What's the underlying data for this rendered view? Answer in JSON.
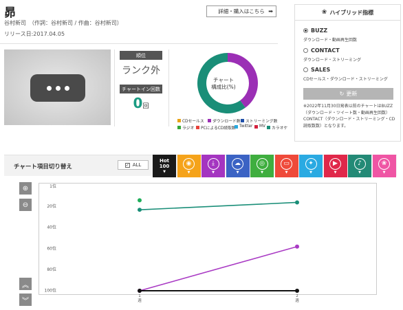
{
  "song": {
    "title": "昴",
    "credits": "谷村新司　（作詞：谷村新司 / 作曲：谷村新司）",
    "release": "リリース日:2017.04.05"
  },
  "buy_button": {
    "label": "詳細・購入はこちら",
    "arrow": "➡"
  },
  "rank": {
    "label": "順位",
    "value": "ランク外"
  },
  "chart_in": {
    "label": "チャートイン回数",
    "value": "0",
    "unit": "回"
  },
  "donut": {
    "center_line1": "チャート",
    "center_line2": "構成比(%)",
    "segments": [
      {
        "name": "ダウンロード数",
        "value": 40,
        "color": "#9b2fb5"
      },
      {
        "name": "カラオケ",
        "value": 60,
        "color": "#1a8e78"
      }
    ],
    "legend": [
      {
        "label": "CDセールス",
        "color": "#e8a317"
      },
      {
        "label": "ダウンロード数",
        "color": "#9b2fb5"
      },
      {
        "label": "ストリーミング数",
        "color": "#1f4fa8"
      },
      {
        "label": "ラジオ",
        "color": "#35a83a"
      },
      {
        "label": "PCによるCD読取数",
        "color": "#e8423a"
      },
      {
        "label": "Twitter",
        "color": "#2aa9e0"
      },
      {
        "label": "MV",
        "color": "#d4213d"
      },
      {
        "label": "カラオケ",
        "color": "#1a8e78"
      }
    ]
  },
  "hybrid": {
    "title": "ハイブリッド指標",
    "options": [
      {
        "label": "BUZZ",
        "sub": "ダウンロード・動画再生回数",
        "selected": true
      },
      {
        "label": "CONTACT",
        "sub": "ダウンロード・ストリーミング",
        "selected": false
      },
      {
        "label": "SALES",
        "sub": "CDセールス・ダウンロード・ストリーミング",
        "selected": false
      }
    ],
    "update_label": "更新",
    "note": "※2022年11月30日発表以前のチャートはBUZZ（ダウンロード・ツイート数・動画再生回数）CONTACT（ダウンロード・ストリーミング・CD読取数数）となります。"
  },
  "toggle": {
    "title": "チャート項目切り替え",
    "all_label": "ALL",
    "categories": [
      {
        "name": "hot100",
        "label1": "Hot",
        "label2": "100",
        "color": "#1a1a1a"
      },
      {
        "name": "cd",
        "color": "#f5a31a"
      },
      {
        "name": "download",
        "color": "#a435c0"
      },
      {
        "name": "streaming",
        "color": "#3b63c4"
      },
      {
        "name": "radio",
        "color": "#3fae3f"
      },
      {
        "name": "pc",
        "color": "#ef4a3a"
      },
      {
        "name": "twitter",
        "color": "#2aaae2"
      },
      {
        "name": "video",
        "color": "#e0284a"
      },
      {
        "name": "karaoke",
        "color": "#238a76"
      },
      {
        "name": "lookup",
        "color": "#ef55a4"
      }
    ]
  },
  "chart_data": {
    "type": "line",
    "x": [
      "1週",
      "2週"
    ],
    "ytick_labels": [
      "1位",
      "20位",
      "40位",
      "60位",
      "80位",
      "100位"
    ],
    "ylim": [
      1,
      100
    ],
    "y_inverted": true,
    "series": [
      {
        "color": "#1a8e78",
        "values": [
          24,
          17
        ]
      },
      {
        "color": "#a93ac4",
        "values": [
          101,
          59
        ]
      },
      {
        "color": "#111111",
        "values": [
          101,
          101
        ]
      }
    ],
    "extra_points": [
      {
        "x": "1週",
        "y": 15,
        "color": "#1fae5a"
      }
    ]
  }
}
